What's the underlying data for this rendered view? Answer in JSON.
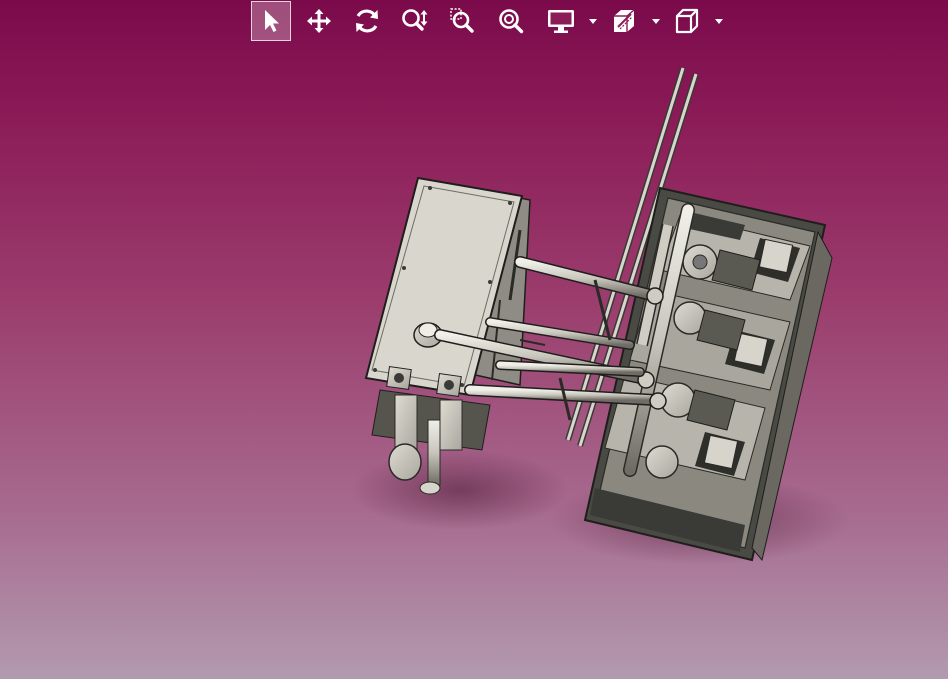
{
  "viewer": {
    "background_top": "#7a0a4a",
    "background_bottom": "#b29ab0",
    "toolbar": {
      "icon_color": "#ffffff",
      "buttons": [
        {
          "name": "select-button",
          "icon": "pointer-arrow-icon",
          "active": true
        },
        {
          "name": "pan-button",
          "icon": "move-arrows-icon",
          "active": false
        },
        {
          "name": "rotate-button",
          "icon": "rotate-icon",
          "active": false
        },
        {
          "name": "zoom-button",
          "icon": "zoom-updown-icon",
          "active": false
        },
        {
          "name": "zoom-window-button",
          "icon": "zoom-window-icon",
          "active": false
        },
        {
          "name": "zoom-fit-button",
          "icon": "zoom-fit-icon",
          "active": false
        },
        {
          "name": "display-mode-button",
          "icon": "monitor-icon",
          "active": false,
          "dropdown": true
        },
        {
          "name": "section-button",
          "icon": "section-cube-icon",
          "active": false,
          "dropdown": true
        },
        {
          "name": "view-orientation-button",
          "icon": "cube-view-icon",
          "active": false,
          "dropdown": true
        }
      ]
    },
    "model": {
      "description_icon": "cad-assembly-model",
      "color_metal": "#c9c7bd",
      "color_dark": "#3a3a36",
      "color_edge": "#1e1e1c"
    }
  }
}
